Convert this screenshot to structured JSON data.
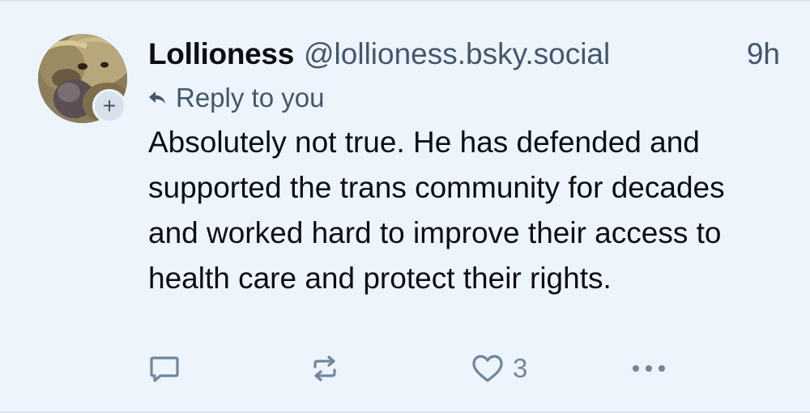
{
  "post": {
    "author": {
      "display_name": "Lollioness",
      "handle": "@lollioness.bsky.social"
    },
    "timestamp": "9h",
    "reply_context": "Reply to you",
    "text": "Absolutely not true. He has defended and supported the trans community for decades and worked hard to improve their access to health care and protect their rights.",
    "follow_badge": "+",
    "actions": {
      "reply": {
        "icon": "comment-icon",
        "count": ""
      },
      "repost": {
        "icon": "repost-icon",
        "count": ""
      },
      "like": {
        "icon": "heart-icon",
        "count": "3"
      },
      "more": {
        "icon": "more-horizontal-icon"
      }
    }
  },
  "colors": {
    "background": "#eef4fb",
    "text_primary": "#0b0f14",
    "text_secondary": "#42576c",
    "icon_muted": "#6f869f"
  }
}
